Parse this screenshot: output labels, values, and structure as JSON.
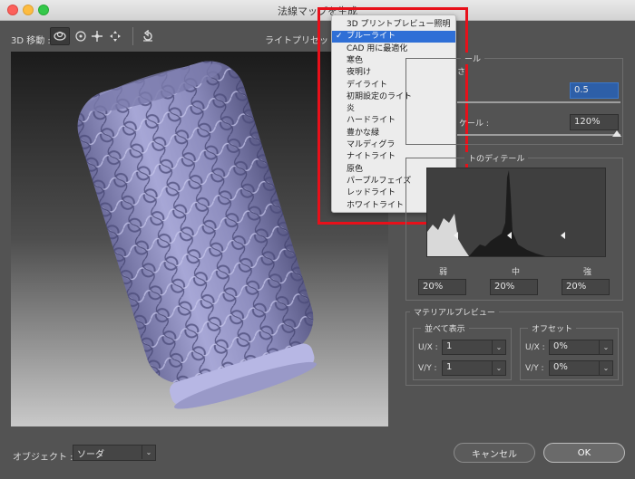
{
  "window": {
    "title": "法線マップを生成"
  },
  "toolbar": {
    "move_label": "3D 移動 :",
    "preset_label": "ライトプリセット",
    "icons": [
      "orbit-icon",
      "roll-icon",
      "pan-icon",
      "slide-icon",
      "reset-icon"
    ]
  },
  "dropdown": {
    "items": [
      "3D プリントプレビュー照明",
      "ブルーライト",
      "CAD 用に最適化",
      "寒色",
      "夜明け",
      "デイライト",
      "初期設定のライト",
      "炎",
      "ハードライト",
      "豊かな緑",
      "マルディグラ",
      "ナイトライト",
      "原色",
      "パープルフェイズ",
      "レッドライト",
      "ホワイトライト"
    ],
    "selected_index": 1,
    "check_mark": "✓"
  },
  "right_panel": {
    "partial_label_1": "ール",
    "partial_label_2": "さ",
    "blur_value": "0.5",
    "scale_partial": "ケール :",
    "scale_value": "120%",
    "detail_title": "トのディテール",
    "detail_labels": {
      "weak": "弱",
      "medium": "中",
      "strong": "強"
    },
    "detail_values": {
      "weak": "20%",
      "medium": "20%",
      "strong": "20%"
    }
  },
  "material": {
    "title": "マテリアルプレビュー",
    "tile_title": "並べて表示",
    "offset_title": "オフセット",
    "ux_label": "U/X :",
    "vy_label": "V/Y :",
    "tile_u": "1",
    "tile_v": "1",
    "offset_u": "0%",
    "offset_v": "0%",
    "arrow": "⌄"
  },
  "footer": {
    "object_label": "オブジェクト :",
    "object_value": "ソーダ",
    "cancel_label": "キャンセル",
    "ok_label": "OK"
  },
  "colors": {
    "accent": "#2f6fd6",
    "highlight_box": "#e8101a",
    "can": "#8f8fc4"
  }
}
